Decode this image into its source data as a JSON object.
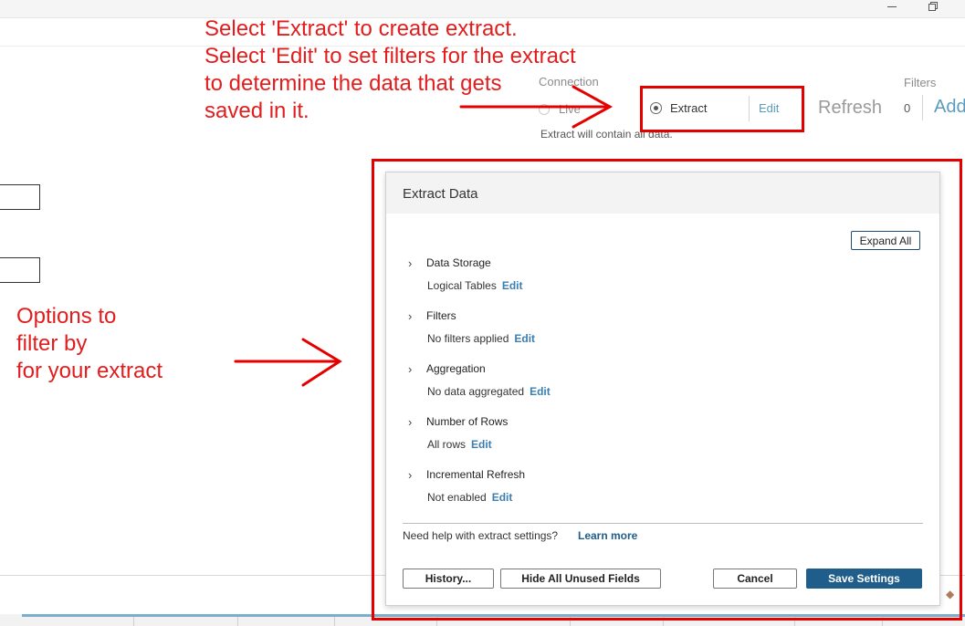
{
  "window": {
    "minimize_icon": "minimize-icon",
    "restore_icon": "restore-icon"
  },
  "connection": {
    "label": "Connection",
    "live_label": "Live",
    "extract_label": "Extract",
    "edit_label": "Edit",
    "refresh_label": "Refresh",
    "filters_label": "Filters",
    "filters_count": "0",
    "add_label": "Add",
    "selected": "Extract",
    "note": "Extract will contain all data."
  },
  "annotations": {
    "top_lines": [
      "Select 'Extract' to create extract.",
      "Select 'Edit' to set filters for the extract",
      "to determine the data that gets",
      "saved in it."
    ],
    "left_lines": [
      "Options to",
      "filter by",
      "for your extract"
    ],
    "color": "#e11d1d"
  },
  "dialog": {
    "title": "Extract Data",
    "expand_all": "Expand All",
    "sections": [
      {
        "title": "Data Storage",
        "value": "Logical Tables",
        "edit": "Edit"
      },
      {
        "title": "Filters",
        "value": "No filters applied",
        "edit": "Edit"
      },
      {
        "title": "Aggregation",
        "value": "No data aggregated",
        "edit": "Edit"
      },
      {
        "title": "Number of Rows",
        "value": "All rows",
        "edit": "Edit"
      },
      {
        "title": "Incremental Refresh",
        "value": "Not enabled",
        "edit": "Edit"
      }
    ],
    "help_text": "Need help with extract settings?",
    "learn_more": "Learn more",
    "buttons": {
      "history": "History...",
      "hide_unused": "Hide All Unused Fields",
      "cancel": "Cancel",
      "save": "Save Settings"
    },
    "accent_color": "#1f5d8a"
  }
}
